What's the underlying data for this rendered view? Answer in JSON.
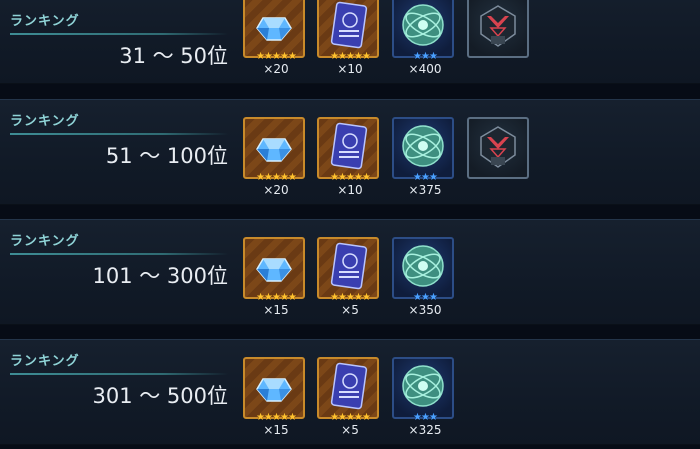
{
  "rewards_list": [
    {
      "label": "ランキング",
      "range": "31 ～ 50位",
      "items": [
        {
          "icon": "blue-gem-icon",
          "frame": "gold",
          "stars": "★★★★★",
          "star_color": "gold",
          "quantity": "×20"
        },
        {
          "icon": "blue-book-icon",
          "frame": "gold",
          "stars": "★★★★★",
          "star_color": "gold",
          "quantity": "×10"
        },
        {
          "icon": "green-orb-icon",
          "frame": "blue",
          "stars": "★★★",
          "star_color": "blue",
          "quantity": "×400"
        },
        {
          "icon": "red-crest-emblem-icon",
          "frame": "dark",
          "stars": "",
          "star_color": "none",
          "quantity": ""
        }
      ]
    },
    {
      "label": "ランキング",
      "range": "51 ～ 100位",
      "items": [
        {
          "icon": "blue-gem-icon",
          "frame": "gold",
          "stars": "★★★★★",
          "star_color": "gold",
          "quantity": "×20"
        },
        {
          "icon": "blue-book-icon",
          "frame": "gold",
          "stars": "★★★★★",
          "star_color": "gold",
          "quantity": "×10"
        },
        {
          "icon": "green-orb-icon",
          "frame": "blue",
          "stars": "★★★",
          "star_color": "blue",
          "quantity": "×375"
        },
        {
          "icon": "red-crest-emblem-icon",
          "frame": "dark",
          "stars": "",
          "star_color": "none",
          "quantity": ""
        }
      ]
    },
    {
      "label": "ランキング",
      "range": "101 ～ 300位",
      "items": [
        {
          "icon": "blue-gem-icon",
          "frame": "gold",
          "stars": "★★★★★",
          "star_color": "gold",
          "quantity": "×15"
        },
        {
          "icon": "blue-book-icon",
          "frame": "gold",
          "stars": "★★★★★",
          "star_color": "gold",
          "quantity": "×5"
        },
        {
          "icon": "green-orb-icon",
          "frame": "blue",
          "stars": "★★★",
          "star_color": "blue",
          "quantity": "×350"
        }
      ]
    },
    {
      "label": "ランキング",
      "range": "301 ～ 500位",
      "items": [
        {
          "icon": "blue-gem-icon",
          "frame": "gold",
          "stars": "★★★★★",
          "star_color": "gold",
          "quantity": "×15"
        },
        {
          "icon": "blue-book-icon",
          "frame": "gold",
          "stars": "★★★★★",
          "star_color": "gold",
          "quantity": "×5"
        },
        {
          "icon": "green-orb-icon",
          "frame": "blue",
          "stars": "★★★",
          "star_color": "blue",
          "quantity": "×325"
        }
      ]
    }
  ],
  "colors": {
    "label": "#8fd3d6",
    "range_text": "#e9edf2",
    "gold_star": "#ffc22e",
    "blue_star": "#4aa0ff",
    "gold_frame": "#c88a2a",
    "blue_frame": "#2c4d86",
    "emblem_red": "#d8434f"
  }
}
